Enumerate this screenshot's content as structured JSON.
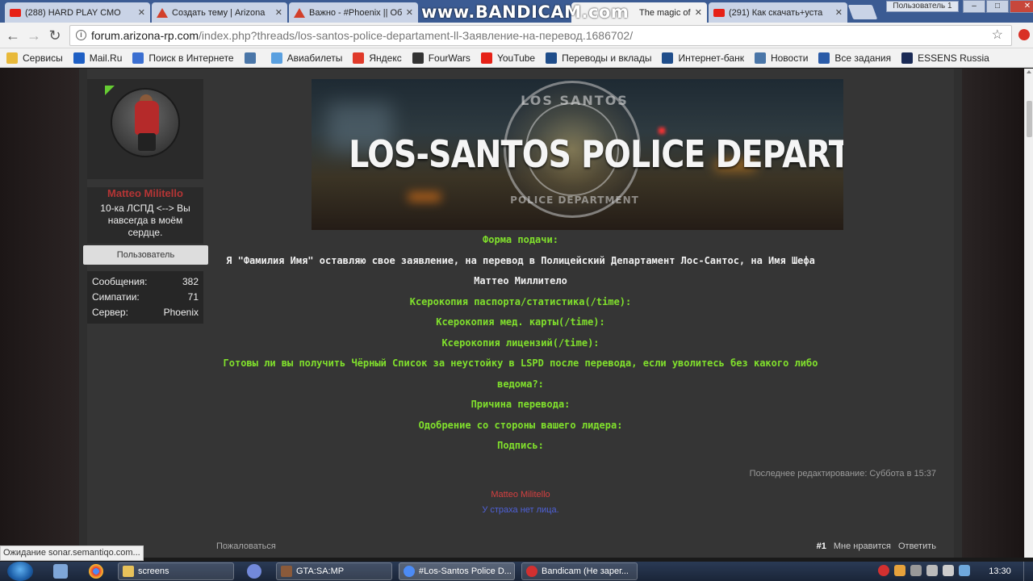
{
  "browser": {
    "tabs": [
      {
        "title": "(288) HARD PLAY СМО",
        "icon": "youtube-icon",
        "active": false
      },
      {
        "title": "Создать тему | Arizona",
        "icon": "arizona-icon",
        "active": false
      },
      {
        "title": "Важно - #Phoenix || Об",
        "icon": "arizona-icon",
        "active": false
      },
      {
        "title": "The magic of the",
        "icon": "youtube-icon",
        "active": true
      },
      {
        "title": "(291) Как скачать+уста",
        "icon": "youtube-icon",
        "active": false
      }
    ],
    "watermark": "www.BANDICAM.com",
    "profile_label": "Пользователь 1",
    "url_host": "forum.arizona-rp.com",
    "url_path": "/index.php?threads/los-santos-police-departament-ll-Заявление-на-перевод.1686702/",
    "bookmarks": [
      {
        "label": "Сервисы",
        "color": "#e8b93a"
      },
      {
        "label": "Mail.Ru",
        "color": "#1e5fc4"
      },
      {
        "label": "Поиск в Интернете",
        "color": "#3b6fd1"
      },
      {
        "label": "",
        "color": "#4a76a8"
      },
      {
        "label": "Авиабилеты",
        "color": "#5aa0e0"
      },
      {
        "label": "Яндекс",
        "color": "#e03a2a"
      },
      {
        "label": "FourWars",
        "color": "#333333"
      },
      {
        "label": "YouTube",
        "color": "#e62117"
      },
      {
        "label": "Переводы и вклады",
        "color": "#1f4d8a"
      },
      {
        "label": "Интернет-банк",
        "color": "#1f4d8a"
      },
      {
        "label": "Новости",
        "color": "#4a76a8"
      },
      {
        "label": "Все задания",
        "color": "#2a5ba8"
      },
      {
        "label": "ESSENS Russia",
        "color": "#1a2a55"
      }
    ],
    "status_text": "Ожидание sonar.semantiqo.com..."
  },
  "post": {
    "author": {
      "name": "Matteo Militello",
      "title": "10-ка ЛСПД <--> Вы навсегда в моём сердце.",
      "badge": "Пользователь",
      "stats": [
        {
          "label": "Сообщения:",
          "value": "382"
        },
        {
          "label": "Симпатии:",
          "value": "71"
        },
        {
          "label": "Сервер:",
          "value": "Phoenix"
        }
      ]
    },
    "banner": {
      "title": "LOS-SANTOS POLICE DEPARTMENT",
      "seal_top": "LOS SANTOS",
      "seal_bottom": "POLICE DEPARTMENT"
    },
    "lines": [
      {
        "text": "Форма подачи:",
        "color": "green"
      },
      {
        "text": "Я \"Фамилия Имя\" оставляю свое заявление, на перевод в Полицейский Департамент Лос-Сантос, на Имя Шефа",
        "color": "white"
      },
      {
        "text": "Маттео Миллитело",
        "color": "white"
      },
      {
        "text": "Ксерокопия паспорта/статистика(/time):",
        "color": "green"
      },
      {
        "text": "Ксерокопия мед. карты(/time):",
        "color": "green"
      },
      {
        "text": "Ксерокопия лицензий(/time):",
        "color": "green"
      },
      {
        "text": "Готовы ли вы получить Чёрный Список за неустойку в LSPD после перевода, если уволитесь без какого либо",
        "color": "green"
      },
      {
        "text": "ведома?:",
        "color": "green"
      },
      {
        "text": "Причина перевода:",
        "color": "green"
      },
      {
        "text": "Одобрение со стороны вашего лидера:",
        "color": "green"
      },
      {
        "text": "Подпись:",
        "color": "green"
      }
    ],
    "edited": "Последнее редактирование: Суббота в 15:37",
    "signature_name": "Matteo Militello",
    "signature_line": "У страха нет лица.",
    "footer": {
      "left": "Пожаловаться",
      "post_number": "#1",
      "like": "Мне нравится",
      "reply": "Ответить"
    }
  },
  "taskbar": {
    "buttons": [
      {
        "label": "screens",
        "color": "#e8c25a"
      },
      {
        "label": "GTA:SA:MP",
        "color": "#8a5a3a"
      },
      {
        "label": "#Los-Santos Police D...",
        "color": "#4c8bf5"
      },
      {
        "label": "Bandicam (Не зарег...",
        "color": "#d23030"
      }
    ],
    "clock": "13:30"
  }
}
